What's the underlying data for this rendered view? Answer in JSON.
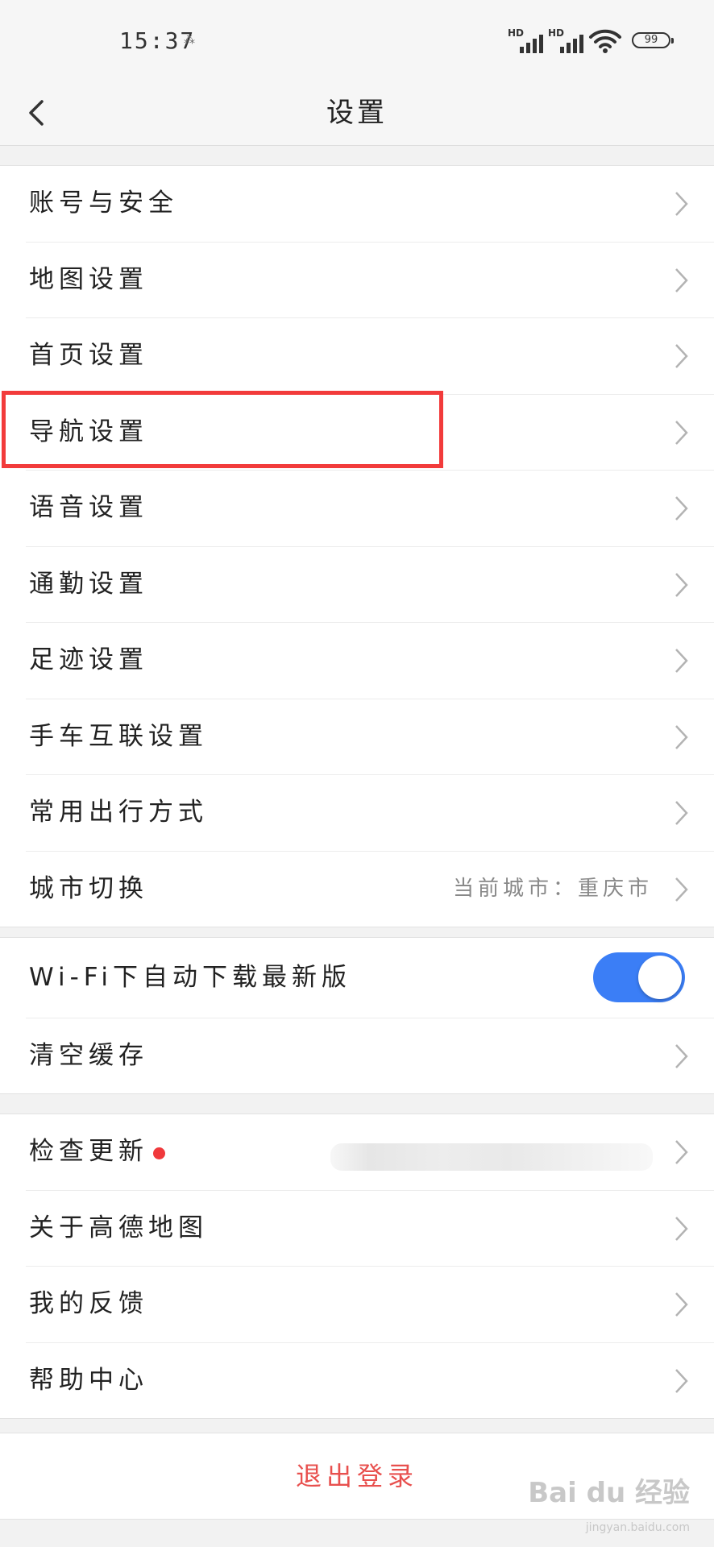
{
  "status": {
    "time": "15:37",
    "signal1_label": "HD",
    "signal2_label": "HD",
    "battery": "99"
  },
  "header": {
    "title": "设置"
  },
  "group1": [
    {
      "label": "账号与安全"
    },
    {
      "label": "地图设置"
    },
    {
      "label": "首页设置"
    },
    {
      "label": "导航设置"
    },
    {
      "label": "语音设置"
    },
    {
      "label": "通勤设置"
    },
    {
      "label": "足迹设置"
    },
    {
      "label": "手车互联设置"
    },
    {
      "label": "常用出行方式"
    },
    {
      "label": "城市切换",
      "value": "当前城市：重庆市"
    }
  ],
  "group2": [
    {
      "label": "Wi-Fi下自动下载最新版",
      "toggle_on": true
    },
    {
      "label": "清空缓存"
    }
  ],
  "group3": [
    {
      "label": "检查更新",
      "badge_color": "#f0393c"
    },
    {
      "label": "关于高德地图"
    },
    {
      "label": "我的反馈"
    },
    {
      "label": "帮助中心"
    }
  ],
  "logout_label": "退出登录",
  "watermark": {
    "main": "Bai du 经验",
    "sub": "jingyan.baidu.com"
  },
  "colors": {
    "accent_toggle": "#3b7ef6",
    "logout": "#e8504e",
    "highlight": "#f23b3b"
  }
}
